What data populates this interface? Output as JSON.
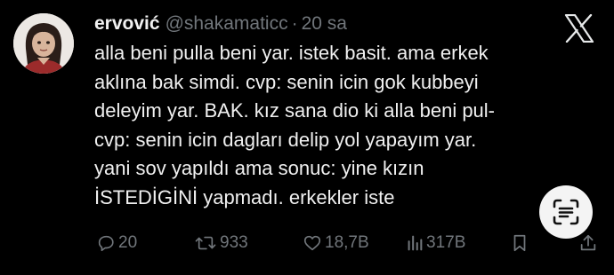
{
  "tweet": {
    "author_name": "ervović",
    "handle": "@shakamaticc",
    "separator": "·",
    "time": "20 sa",
    "lines": [
      "alla beni pulla beni yar. istek basit. ama erkek",
      "aklına bak simdi. cvp: senin icin gok kubbeyi",
      "deleyim yar. BAK. kız sana dio ki alla beni pul-",
      "cvp: senin icin dagları delip yol yapayım yar.",
      "yani sov yapıldı ama sonuc: yine kızın",
      "İSTEDİGİNİ yapmadı. erkekler iste"
    ]
  },
  "actions": {
    "replies": "20",
    "reposts": "933",
    "likes": "18,7B",
    "views": "317B"
  },
  "icons": {
    "brand": "x-logo-icon",
    "reply": "reply-icon",
    "repost": "repost-icon",
    "like": "heart-icon",
    "views": "views-icon",
    "bookmark": "bookmark-icon",
    "share": "share-icon",
    "scan": "text-scan-icon"
  },
  "colors": {
    "background": "#000000",
    "text": "#e7e9ea",
    "muted": "#71767b"
  }
}
